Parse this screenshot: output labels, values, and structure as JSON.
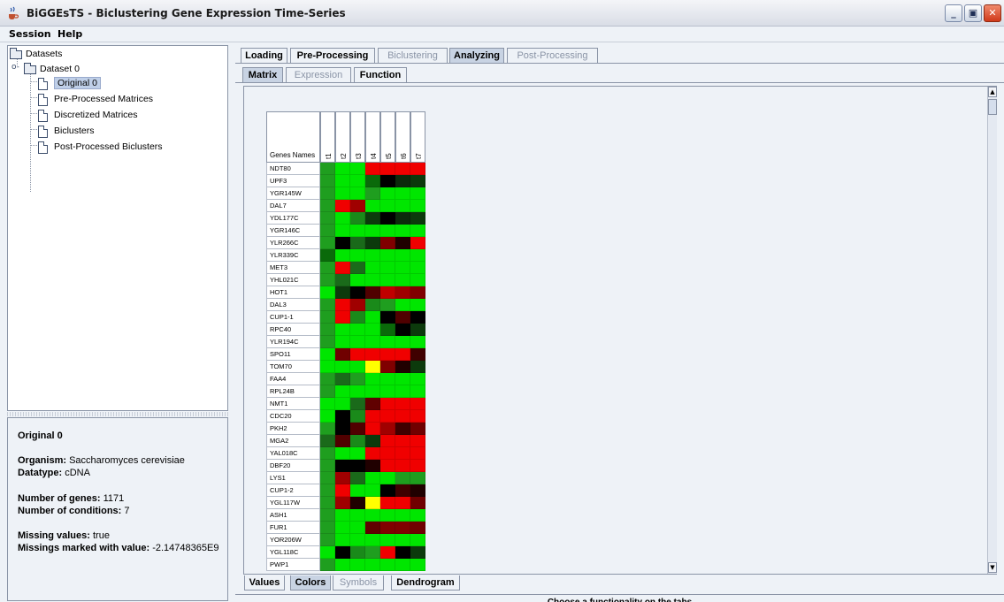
{
  "window": {
    "title": "BiGGEsTS - Biclustering Gene Expression Time-Series"
  },
  "menu": {
    "items": [
      "Session",
      "Help"
    ]
  },
  "tree": {
    "root": "Datasets",
    "dataset": "Dataset 0",
    "children": [
      "Original 0",
      "Pre-Processed Matrices",
      "Discretized Matrices",
      "Biclusters",
      "Post-Processed Biclusters"
    ]
  },
  "info": {
    "title": "Original 0",
    "organism_label": "Organism:",
    "organism_value": "Saccharomyces cerevisiae",
    "datatype_label": "Datatype:",
    "datatype_value": "cDNA",
    "genes_label": "Number of genes:",
    "genes_value": "1171",
    "conditions_label": "Number of conditions:",
    "conditions_value": "7",
    "missing_label": "Missing values:",
    "missing_value": "true",
    "missing_marked_label": "Missings marked with value:",
    "missing_marked_value": "-2.14748365E9"
  },
  "tabs": {
    "main": [
      "Loading",
      "Pre-Processing",
      "Biclustering",
      "Analyzing",
      "Post-Processing"
    ],
    "sub": [
      "Matrix",
      "Expression",
      "Function"
    ],
    "bottom": [
      "Values",
      "Colors",
      "Symbols",
      "Dendrogram"
    ]
  },
  "matrix": {
    "header": "Genes Names",
    "conditions": [
      "t1",
      "t2",
      "t3",
      "t4",
      "t5",
      "t6",
      "t7"
    ],
    "genes": [
      "NDT80",
      "UPF3",
      "YGR145W",
      "DAL7",
      "YDL177C",
      "YGR146C",
      "YLR266C",
      "YLR339C",
      "MET3",
      "YHL021C",
      "HOT1",
      "DAL3",
      "CUP1-1",
      "RPC40",
      "YLR194C",
      "SPO11",
      "TOM70",
      "FAA4",
      "RPL24B",
      "NMT1",
      "CDC20",
      "PKH2",
      "MGA2",
      "YAL018C",
      "DBF20",
      "LYS1",
      "CUP1-2",
      "YGL117W",
      "ASH1",
      "FUR1",
      "YOR206W",
      "YGL118C",
      "PWP1"
    ],
    "cell_colors": [
      [
        "#1f9e1f",
        "#00e600",
        "#00e600",
        "#f00000",
        "#f00000",
        "#f00000",
        "#f00000"
      ],
      [
        "#1f9e1f",
        "#00e600",
        "#00e600",
        "#0a6a0a",
        "#000000",
        "#0c2a0c",
        "#0c3a0c"
      ],
      [
        "#1f9e1f",
        "#00e600",
        "#00e600",
        "#1f9e1f",
        "#00e600",
        "#00e600",
        "#00e600"
      ],
      [
        "#1f9e1f",
        "#f00000",
        "#a00000",
        "#00e600",
        "#00e600",
        "#00e600",
        "#00e600"
      ],
      [
        "#1f9e1f",
        "#00e600",
        "#1a8a1a",
        "#0c3a0c",
        "#000000",
        "#0c2a0c",
        "#0c3a0c"
      ],
      [
        "#1f9e1f",
        "#00e600",
        "#00e600",
        "#00e600",
        "#00e600",
        "#00e600",
        "#00e600"
      ],
      [
        "#1f9e1f",
        "#000000",
        "#1a6a1a",
        "#0c3a0c",
        "#800000",
        "#200000",
        "#f00000"
      ],
      [
        "#0a6a0a",
        "#00e600",
        "#00e600",
        "#00e600",
        "#00e600",
        "#00e600",
        "#00e600"
      ],
      [
        "#1f9e1f",
        "#f00000",
        "#1a6a1a",
        "#00e600",
        "#00e600",
        "#00e600",
        "#00e600"
      ],
      [
        "#1f9e1f",
        "#1a6a1a",
        "#00e600",
        "#00e600",
        "#00e600",
        "#00e600",
        "#00e600"
      ],
      [
        "#00e600",
        "#0c3a0c",
        "#000000",
        "#500000",
        "#c00000",
        "#a00000",
        "#800000"
      ],
      [
        "#1f9e1f",
        "#f00000",
        "#a00000",
        "#1a8a1a",
        "#1f9e1f",
        "#00e600",
        "#00e600"
      ],
      [
        "#1f9e1f",
        "#f00000",
        "#1a8a1a",
        "#00e600",
        "#000000",
        "#500000",
        "#000000"
      ],
      [
        "#1f9e1f",
        "#00e600",
        "#00e600",
        "#00e600",
        "#0a6a0a",
        "#000000",
        "#0c3a0c"
      ],
      [
        "#1f9e1f",
        "#00e600",
        "#00e600",
        "#00e600",
        "#00e600",
        "#00e600",
        "#00e600"
      ],
      [
        "#00e600",
        "#700000",
        "#f00000",
        "#f00000",
        "#f00000",
        "#f00000",
        "#400000"
      ],
      [
        "#00e600",
        "#00e600",
        "#00e600",
        "#ffff00",
        "#800000",
        "#200000",
        "#0c3a0c"
      ],
      [
        "#1f9e1f",
        "#1a6a1a",
        "#1f9e1f",
        "#00e600",
        "#00e600",
        "#00e600",
        "#00e600"
      ],
      [
        "#1f9e1f",
        "#00e600",
        "#00e600",
        "#00e600",
        "#00e600",
        "#00e600",
        "#00e600"
      ],
      [
        "#00e600",
        "#00e600",
        "#1a6a1a",
        "#600000",
        "#f00000",
        "#f00000",
        "#f00000"
      ],
      [
        "#00e600",
        "#000000",
        "#1a8a1a",
        "#f00000",
        "#f00000",
        "#f00000",
        "#f00000"
      ],
      [
        "#1f9e1f",
        "#000000",
        "#500000",
        "#f00000",
        "#a00000",
        "#400000",
        "#700000"
      ],
      [
        "#1a6a1a",
        "#500000",
        "#1a8a1a",
        "#0c3a0c",
        "#f00000",
        "#f00000",
        "#f00000"
      ],
      [
        "#1f9e1f",
        "#00e600",
        "#00e600",
        "#f00000",
        "#f00000",
        "#f00000",
        "#f00000"
      ],
      [
        "#1f9e1f",
        "#000000",
        "#000000",
        "#200000",
        "#f00000",
        "#f00000",
        "#f00000"
      ],
      [
        "#1f9e1f",
        "#a00000",
        "#1a6a1a",
        "#00e600",
        "#00e600",
        "#1f9e1f",
        "#1f9e1f"
      ],
      [
        "#1f9e1f",
        "#f00000",
        "#00e600",
        "#00e600",
        "#000000",
        "#400000",
        "#200000"
      ],
      [
        "#1f9e1f",
        "#a00000",
        "#200000",
        "#ffff00",
        "#f00000",
        "#f00000",
        "#700000"
      ],
      [
        "#1f9e1f",
        "#00e600",
        "#00e600",
        "#00e600",
        "#00e600",
        "#00e600",
        "#00e600"
      ],
      [
        "#1f9e1f",
        "#00e600",
        "#00e600",
        "#600000",
        "#800000",
        "#800000",
        "#700000"
      ],
      [
        "#1f9e1f",
        "#00e600",
        "#00e600",
        "#00e600",
        "#00e600",
        "#00e600",
        "#00e600"
      ],
      [
        "#00e600",
        "#000000",
        "#1a8a1a",
        "#1f9e1f",
        "#f00000",
        "#000000",
        "#0c3a0c"
      ],
      [
        "#1f9e1f",
        "#00e600",
        "#00e600",
        "#00e600",
        "#00e600",
        "#00e600",
        "#00e600"
      ]
    ]
  },
  "status": "Choose a functionality on the tabs"
}
